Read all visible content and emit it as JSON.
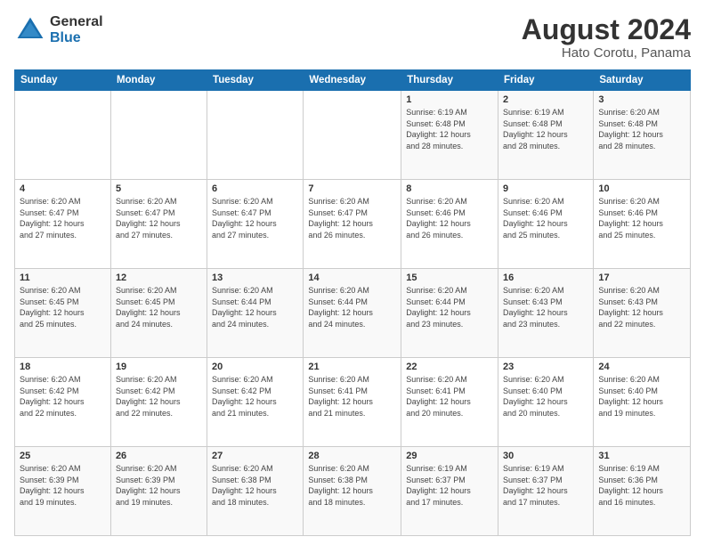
{
  "header": {
    "logo_general": "General",
    "logo_blue": "Blue",
    "month_year": "August 2024",
    "location": "Hato Corotu, Panama"
  },
  "days_of_week": [
    "Sunday",
    "Monday",
    "Tuesday",
    "Wednesday",
    "Thursday",
    "Friday",
    "Saturday"
  ],
  "weeks": [
    [
      {
        "day": "",
        "info": ""
      },
      {
        "day": "",
        "info": ""
      },
      {
        "day": "",
        "info": ""
      },
      {
        "day": "",
        "info": ""
      },
      {
        "day": "1",
        "info": "Sunrise: 6:19 AM\nSunset: 6:48 PM\nDaylight: 12 hours\nand 28 minutes."
      },
      {
        "day": "2",
        "info": "Sunrise: 6:19 AM\nSunset: 6:48 PM\nDaylight: 12 hours\nand 28 minutes."
      },
      {
        "day": "3",
        "info": "Sunrise: 6:20 AM\nSunset: 6:48 PM\nDaylight: 12 hours\nand 28 minutes."
      }
    ],
    [
      {
        "day": "4",
        "info": "Sunrise: 6:20 AM\nSunset: 6:47 PM\nDaylight: 12 hours\nand 27 minutes."
      },
      {
        "day": "5",
        "info": "Sunrise: 6:20 AM\nSunset: 6:47 PM\nDaylight: 12 hours\nand 27 minutes."
      },
      {
        "day": "6",
        "info": "Sunrise: 6:20 AM\nSunset: 6:47 PM\nDaylight: 12 hours\nand 27 minutes."
      },
      {
        "day": "7",
        "info": "Sunrise: 6:20 AM\nSunset: 6:47 PM\nDaylight: 12 hours\nand 26 minutes."
      },
      {
        "day": "8",
        "info": "Sunrise: 6:20 AM\nSunset: 6:46 PM\nDaylight: 12 hours\nand 26 minutes."
      },
      {
        "day": "9",
        "info": "Sunrise: 6:20 AM\nSunset: 6:46 PM\nDaylight: 12 hours\nand 25 minutes."
      },
      {
        "day": "10",
        "info": "Sunrise: 6:20 AM\nSunset: 6:46 PM\nDaylight: 12 hours\nand 25 minutes."
      }
    ],
    [
      {
        "day": "11",
        "info": "Sunrise: 6:20 AM\nSunset: 6:45 PM\nDaylight: 12 hours\nand 25 minutes."
      },
      {
        "day": "12",
        "info": "Sunrise: 6:20 AM\nSunset: 6:45 PM\nDaylight: 12 hours\nand 24 minutes."
      },
      {
        "day": "13",
        "info": "Sunrise: 6:20 AM\nSunset: 6:44 PM\nDaylight: 12 hours\nand 24 minutes."
      },
      {
        "day": "14",
        "info": "Sunrise: 6:20 AM\nSunset: 6:44 PM\nDaylight: 12 hours\nand 24 minutes."
      },
      {
        "day": "15",
        "info": "Sunrise: 6:20 AM\nSunset: 6:44 PM\nDaylight: 12 hours\nand 23 minutes."
      },
      {
        "day": "16",
        "info": "Sunrise: 6:20 AM\nSunset: 6:43 PM\nDaylight: 12 hours\nand 23 minutes."
      },
      {
        "day": "17",
        "info": "Sunrise: 6:20 AM\nSunset: 6:43 PM\nDaylight: 12 hours\nand 22 minutes."
      }
    ],
    [
      {
        "day": "18",
        "info": "Sunrise: 6:20 AM\nSunset: 6:42 PM\nDaylight: 12 hours\nand 22 minutes."
      },
      {
        "day": "19",
        "info": "Sunrise: 6:20 AM\nSunset: 6:42 PM\nDaylight: 12 hours\nand 22 minutes."
      },
      {
        "day": "20",
        "info": "Sunrise: 6:20 AM\nSunset: 6:42 PM\nDaylight: 12 hours\nand 21 minutes."
      },
      {
        "day": "21",
        "info": "Sunrise: 6:20 AM\nSunset: 6:41 PM\nDaylight: 12 hours\nand 21 minutes."
      },
      {
        "day": "22",
        "info": "Sunrise: 6:20 AM\nSunset: 6:41 PM\nDaylight: 12 hours\nand 20 minutes."
      },
      {
        "day": "23",
        "info": "Sunrise: 6:20 AM\nSunset: 6:40 PM\nDaylight: 12 hours\nand 20 minutes."
      },
      {
        "day": "24",
        "info": "Sunrise: 6:20 AM\nSunset: 6:40 PM\nDaylight: 12 hours\nand 19 minutes."
      }
    ],
    [
      {
        "day": "25",
        "info": "Sunrise: 6:20 AM\nSunset: 6:39 PM\nDaylight: 12 hours\nand 19 minutes."
      },
      {
        "day": "26",
        "info": "Sunrise: 6:20 AM\nSunset: 6:39 PM\nDaylight: 12 hours\nand 19 minutes."
      },
      {
        "day": "27",
        "info": "Sunrise: 6:20 AM\nSunset: 6:38 PM\nDaylight: 12 hours\nand 18 minutes."
      },
      {
        "day": "28",
        "info": "Sunrise: 6:20 AM\nSunset: 6:38 PM\nDaylight: 12 hours\nand 18 minutes."
      },
      {
        "day": "29",
        "info": "Sunrise: 6:19 AM\nSunset: 6:37 PM\nDaylight: 12 hours\nand 17 minutes."
      },
      {
        "day": "30",
        "info": "Sunrise: 6:19 AM\nSunset: 6:37 PM\nDaylight: 12 hours\nand 17 minutes."
      },
      {
        "day": "31",
        "info": "Sunrise: 6:19 AM\nSunset: 6:36 PM\nDaylight: 12 hours\nand 16 minutes."
      }
    ]
  ]
}
